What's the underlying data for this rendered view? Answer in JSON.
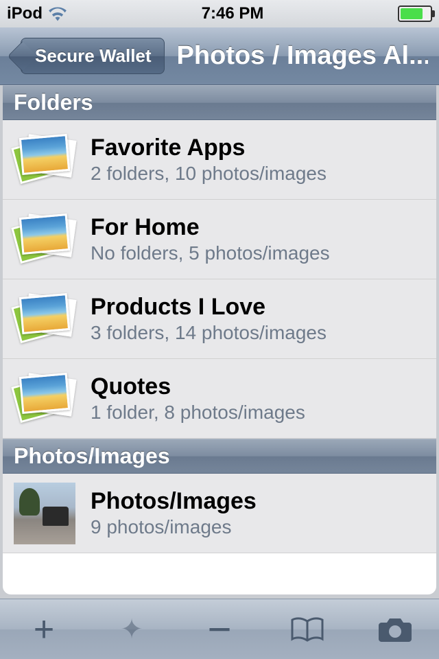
{
  "status_bar": {
    "device": "iPod",
    "time": "7:46 PM"
  },
  "nav": {
    "back_label": "Secure Wallet",
    "title": "Photos / Images Al..."
  },
  "sections": {
    "folders_header": "Folders",
    "photos_header": "Photos/Images"
  },
  "folders": [
    {
      "title": "Favorite Apps",
      "subtitle": "2 folders, 10 photos/images"
    },
    {
      "title": "For Home",
      "subtitle": "No folders, 5 photos/images"
    },
    {
      "title": "Products I Love",
      "subtitle": "3 folders, 14 photos/images"
    },
    {
      "title": "Quotes",
      "subtitle": "1 folder, 8 photos/images"
    }
  ],
  "photos": [
    {
      "title": "Photos/Images",
      "subtitle": "9 photos/images"
    }
  ]
}
